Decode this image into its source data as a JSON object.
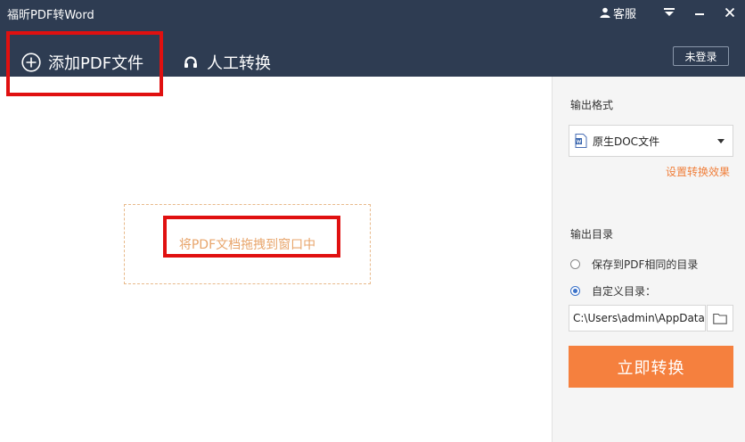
{
  "app": {
    "title": "福昕PDF转Word"
  },
  "window": {
    "kefu_label": "客服"
  },
  "tabs": {
    "add_pdf": "添加PDF文件",
    "manual_convert": "人工转换"
  },
  "login": {
    "label": "未登录"
  },
  "dropzone": {
    "hint": "将PDF文档拖拽到窗口中"
  },
  "sidebar": {
    "output_format_label": "输出格式",
    "format_selected": "原生DOC文件",
    "settings_link": "设置转换效果",
    "output_dir_label": "输出目录",
    "option_same_dir": "保存到PDF相同的目录",
    "option_custom_dir": "自定义目录：",
    "path_value": "C:\\Users\\admin\\AppData",
    "convert_button": "立即转换"
  },
  "colors": {
    "header_bg": "#2e3c52",
    "accent_orange": "#f5803e",
    "highlight_red": "#e01010",
    "dropzone_text": "#e8a56b"
  }
}
